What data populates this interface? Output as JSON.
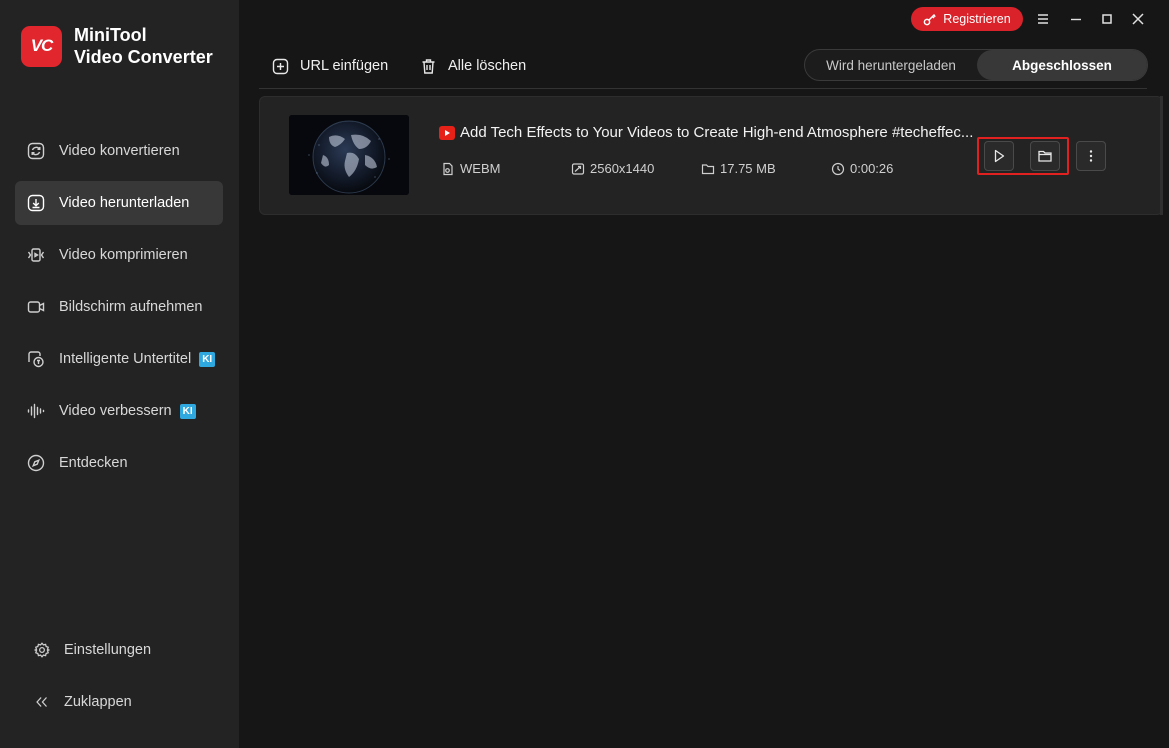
{
  "app": {
    "logo_text": "VC",
    "name_line1": "MiniTool",
    "name_line2": "Video Converter"
  },
  "titlebar": {
    "register_label": "Registrieren",
    "accent": "#d92229"
  },
  "sidebar": {
    "items": [
      {
        "label": "Video konvertieren",
        "icon": "convert-icon"
      },
      {
        "label": "Video herunterladen",
        "icon": "download-icon",
        "active": true
      },
      {
        "label": "Video komprimieren",
        "icon": "compress-icon"
      },
      {
        "label": "Bildschirm aufnehmen",
        "icon": "screen-record-icon"
      },
      {
        "label": "Intelligente Untertitel",
        "icon": "subtitle-icon",
        "badge": "KI"
      },
      {
        "label": "Video verbessern",
        "icon": "enhance-icon",
        "badge": "KI"
      },
      {
        "label": "Entdecken",
        "icon": "compass-icon"
      }
    ],
    "settings_label": "Einstellungen",
    "collapse_label": "Zuklappen"
  },
  "toolbar": {
    "paste_url_label": "URL einfügen",
    "delete_all_label": "Alle löschen",
    "tabs": [
      "Wird heruntergeladen",
      "Abgeschlossen"
    ],
    "active_tab": "Abgeschlossen"
  },
  "downloads": [
    {
      "title": "Add Tech Effects to Your Videos to Create High-end Atmosphere #techeffec...",
      "source_icon": "youtube-icon",
      "format": "WEBM",
      "resolution": "2560x1440",
      "size": "17.75 MB",
      "duration": "0:00:26"
    }
  ]
}
